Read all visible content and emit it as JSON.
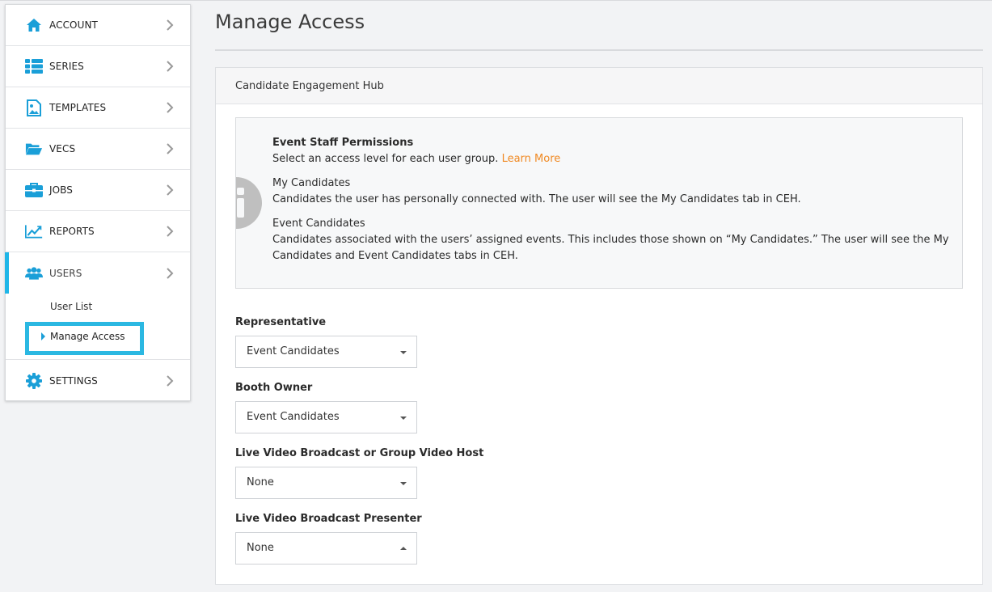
{
  "accent_color": "#1fb6e8",
  "link_color": "#f08a24",
  "sidebar": {
    "items": [
      {
        "label": "ACCOUNT",
        "icon": "home-icon"
      },
      {
        "label": "SERIES",
        "icon": "list-icon"
      },
      {
        "label": "TEMPLATES",
        "icon": "image-icon"
      },
      {
        "label": "VECS",
        "icon": "folder-icon"
      },
      {
        "label": "JOBS",
        "icon": "briefcase-icon"
      },
      {
        "label": "REPORTS",
        "icon": "chart-line-icon"
      },
      {
        "label": "USERS",
        "icon": "users-icon"
      },
      {
        "label": "SETTINGS",
        "icon": "gear-icon"
      }
    ],
    "submenu": {
      "user_list": "User List",
      "manage_access": "Manage Access"
    }
  },
  "page": {
    "title": "Manage Access"
  },
  "panel": {
    "header": "Candidate Engagement Hub",
    "info": {
      "title": "Event Staff Permissions",
      "intro": "Select an access level for each user group.",
      "learn_more": "Learn More",
      "my_candidates_title": "My Candidates",
      "my_candidates_desc": "Candidates the user has personally connected with. The user will see the My Candidates tab in CEH.",
      "event_candidates_title": "Event Candidates",
      "event_candidates_desc": "Candidates associated with the users’ assigned events. This includes those shown on “My Candidates.” The user will see the My Candidates and Event Candidates tabs in CEH."
    },
    "fields": [
      {
        "label": "Representative",
        "value": "Event Candidates"
      },
      {
        "label": "Booth Owner",
        "value": "Event Candidates"
      },
      {
        "label": "Live Video Broadcast or Group Video Host",
        "value": "None"
      },
      {
        "label": "Live Video Broadcast Presenter",
        "value": "None"
      }
    ]
  }
}
